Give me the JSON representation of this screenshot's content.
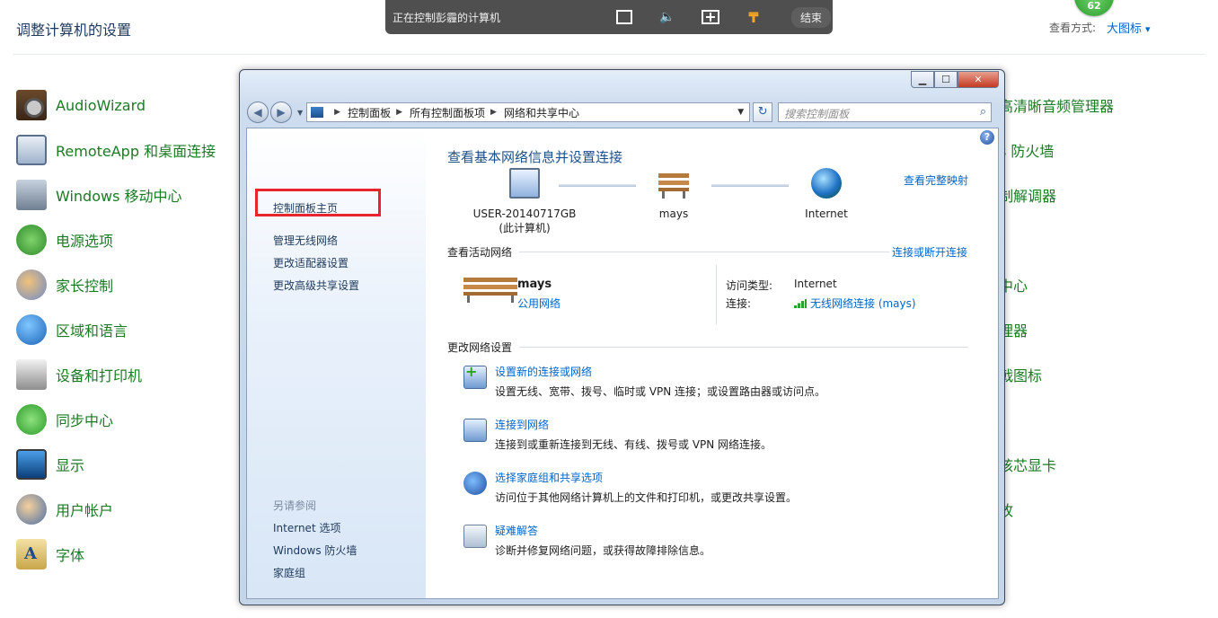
{
  "background": {
    "title": "调整计算机的设置",
    "view_label": "查看方式:",
    "view_value": "大图标",
    "badge": "62",
    "left_items": [
      {
        "label": "AudioWizard",
        "icon": "audio-wizard-icon"
      },
      {
        "label": "RemoteApp 和桌面连接",
        "icon": "remoteapp-icon"
      },
      {
        "label": "Windows 移动中心",
        "icon": "mobility-center-icon"
      },
      {
        "label": "电源选项",
        "icon": "power-options-icon"
      },
      {
        "label": "家长控制",
        "icon": "parental-controls-icon"
      },
      {
        "label": "区域和语言",
        "icon": "region-language-icon"
      },
      {
        "label": "设备和打印机",
        "icon": "devices-printers-icon"
      },
      {
        "label": "同步中心",
        "icon": "sync-center-icon"
      },
      {
        "label": "显示",
        "icon": "display-icon"
      },
      {
        "label": "用户帐户",
        "icon": "user-accounts-icon"
      },
      {
        "label": "字体",
        "icon": "fonts-icon"
      }
    ],
    "right_items": [
      {
        "label": "高清晰音频管理器"
      },
      {
        "label": "s 防火墙"
      },
      {
        "label": "制解调器"
      },
      {
        "label": ""
      },
      {
        "label": "中心"
      },
      {
        "label": "理器"
      },
      {
        "label": "戟图标"
      },
      {
        "label": ""
      },
      {
        "label": "核芯显卡"
      },
      {
        "label": "故"
      }
    ]
  },
  "remote_bar": {
    "title": "正在控制彭霾的计算机",
    "end_label": "结束",
    "icons": [
      "fullscreen-icon",
      "volume-icon",
      "resize-icon",
      "pin-icon"
    ]
  },
  "window": {
    "controls": {
      "minimize": "▁",
      "maximize": "☐",
      "close": "✕"
    },
    "address": {
      "crumbs": [
        "控制面板",
        "所有控制面板项",
        "网络和共享中心"
      ]
    },
    "search": {
      "placeholder": "搜索控制面板"
    },
    "sidebar": {
      "links": [
        "控制面板主页",
        "管理无线网络",
        "更改适配器设置",
        "更改高级共享设置"
      ],
      "see_also_label": "另请参阅",
      "see_also": [
        "Internet 选项",
        "Windows 防火墙",
        "家庭组"
      ]
    },
    "main": {
      "help": "?",
      "title": "查看基本网络信息并设置连接",
      "full_map": "查看完整映射",
      "map": {
        "computer_name": "USER-20140717GB",
        "computer_sub": "(此计算机)",
        "network_name": "mays",
        "internet": "Internet"
      },
      "active_label": "查看活动网络",
      "connect_disconnect": "连接或断开连接",
      "active_network": {
        "name": "mays",
        "type": "公用网络",
        "access_key": "访问类型:",
        "access_value": "Internet",
        "conn_key": "连接:",
        "conn_value": "无线网络连接 (mays)"
      },
      "change_label": "更改网络设置",
      "tasks": [
        {
          "link": "设置新的连接或网络",
          "desc": "设置无线、宽带、拨号、临时或 VPN 连接；或设置路由器或访问点。",
          "icon": "new-connection-icon"
        },
        {
          "link": "连接到网络",
          "desc": "连接到或重新连接到无线、有线、拨号或 VPN 网络连接。",
          "icon": "connect-network-icon"
        },
        {
          "link": "选择家庭组和共享选项",
          "desc": "访问位于其他网络计算机上的文件和打印机，或更改共享设置。",
          "icon": "homegroup-icon"
        },
        {
          "link": "疑难解答",
          "desc": "诊断并修复网络问题，或获得故障排除信息。",
          "icon": "troubleshoot-icon"
        }
      ]
    }
  },
  "colors": {
    "link": "#0066cc",
    "item_green": "#1b7a24",
    "highlight": "#e8242c"
  }
}
